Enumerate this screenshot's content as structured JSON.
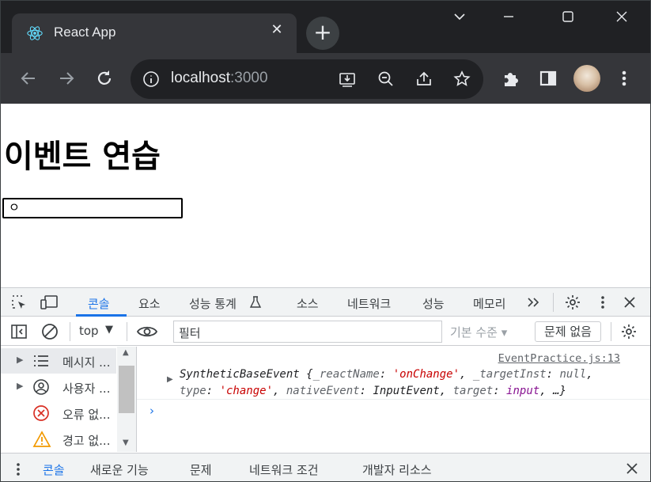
{
  "browser": {
    "tab_title": "React App",
    "url_host": "localhost",
    "url_port": ":3000"
  },
  "page": {
    "heading": "이벤트 연습",
    "input_value": "ㅇ"
  },
  "devtools": {
    "tabs": [
      {
        "label": "콘솔"
      },
      {
        "label": "요소"
      },
      {
        "label": "성능 통계"
      },
      {
        "label": "소스"
      },
      {
        "label": "네트워크"
      },
      {
        "label": "성능"
      },
      {
        "label": "메모리"
      }
    ],
    "context": "top",
    "filter_placeholder": "필터",
    "levels": "기본 수준",
    "issues": "문제 없음",
    "sidebar": [
      {
        "label": "메시지 ..."
      },
      {
        "label": "사용자 ..."
      },
      {
        "label": "오류 없..."
      },
      {
        "label": "경고 없..."
      }
    ],
    "log": {
      "source": "EventPractice.js:13",
      "obj_name": "SyntheticBaseEvent",
      "react_name_key": "_reactName",
      "react_name_val": "'onChange'",
      "target_inst_key": "_targetInst",
      "target_inst_val": "null",
      "type_key": "type",
      "type_val": "'change'",
      "native_key": "nativeEvent",
      "native_val": "InputEvent",
      "target_key": "target",
      "target_val": "input",
      "ellipsis": "…"
    },
    "drawer_tabs": [
      {
        "label": "콘솔"
      },
      {
        "label": "새로운 기능"
      },
      {
        "label": "문제"
      },
      {
        "label": "네트워크 조건"
      },
      {
        "label": "개발자 리소스"
      }
    ]
  },
  "colors": {
    "accent": "#1a73e8",
    "chrome_dark": "#202124",
    "chrome_tab": "#35363a",
    "string_red": "#c80000",
    "warning": "#f29900",
    "error": "#d93025"
  }
}
